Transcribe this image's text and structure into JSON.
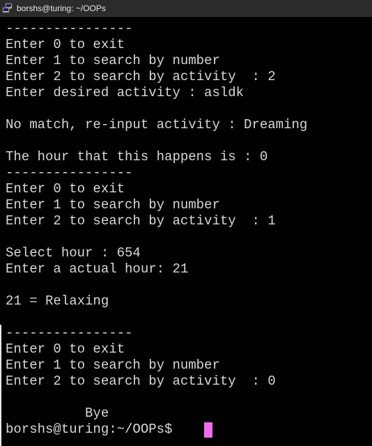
{
  "window": {
    "title": "borshs@turing: ~/OOPs",
    "icon": "putty-icon"
  },
  "terminal": {
    "lines": [
      "----------------",
      "Enter 0 to exit",
      "Enter 1 to search by number",
      "Enter 2 to search by activity  : 2",
      "Enter desired activity : asldk",
      "",
      "No match, re-input activity : Dreaming",
      "",
      "The hour that this happens is : 0",
      "----------------",
      "Enter 0 to exit",
      "Enter 1 to search by number",
      "Enter 2 to search by activity  : 1",
      "",
      "Select hour : 654",
      "Enter a actual hour: 21",
      "",
      "21 = Relaxing",
      "",
      "----------------",
      "Enter 0 to exit",
      "Enter 1 to search by number",
      "Enter 2 to search by activity  : 0",
      "",
      "          Bye",
      "borshs@turing:~/OOPs$ "
    ]
  },
  "colors": {
    "background": "#000000",
    "foreground": "#d8d8d8",
    "cursor": "#f06af0",
    "titlebar": "#2b2b2b"
  }
}
